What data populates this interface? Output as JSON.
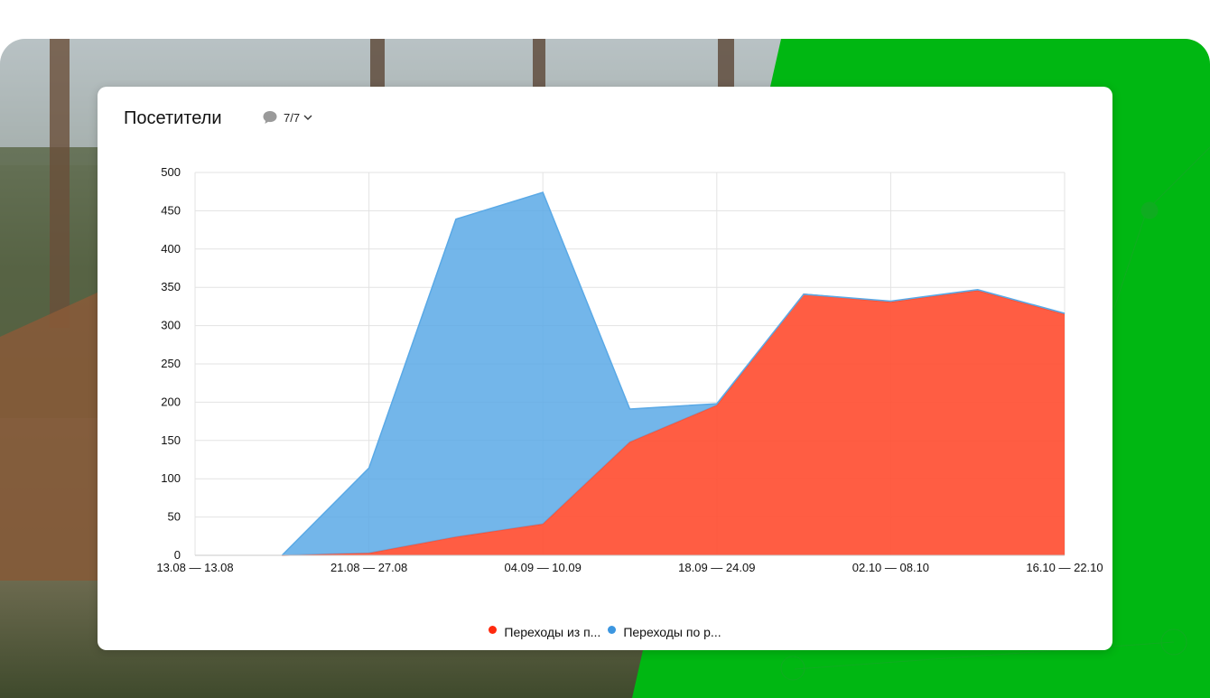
{
  "header": {
    "title": "Посетители",
    "goals_counter": "7/7"
  },
  "colors": {
    "series_red": "#ff4f33",
    "series_blue": "#5aa9e6",
    "brand_green": "#00b712"
  },
  "icons": {
    "goals": "speech-bubble-icon",
    "dropdown": "chevron-down-icon"
  },
  "chart_data": {
    "type": "area",
    "stacked": true,
    "x": [
      "13.08 — 13.08",
      "",
      "21.08 — 27.08",
      "",
      "04.09 — 10.09",
      "",
      "18.09 — 24.09",
      "",
      "02.10 — 08.10",
      "",
      "16.10 — 22.10"
    ],
    "x_tick_labels": [
      "13.08 — 13.08",
      "21.08 — 27.08",
      "04.09 — 10.09",
      "18.09 — 24.09",
      "02.10 — 08.10",
      "16.10 — 22.10"
    ],
    "series": [
      {
        "name": "Переходы из п...",
        "color": "#ff4f33",
        "values": [
          null,
          0,
          3,
          24,
          41,
          148,
          196,
          341,
          331,
          346,
          315
        ]
      },
      {
        "name": "Переходы по р...",
        "color": "#5aa9e6",
        "values": [
          null,
          0,
          111,
          415,
          433,
          43,
          2,
          0,
          1,
          1,
          1
        ]
      }
    ],
    "y_ticks": [
      0,
      50,
      100,
      150,
      200,
      250,
      300,
      350,
      400,
      450,
      500
    ],
    "ylim": [
      0,
      500
    ],
    "grid": true,
    "legend": "bottom-center"
  }
}
